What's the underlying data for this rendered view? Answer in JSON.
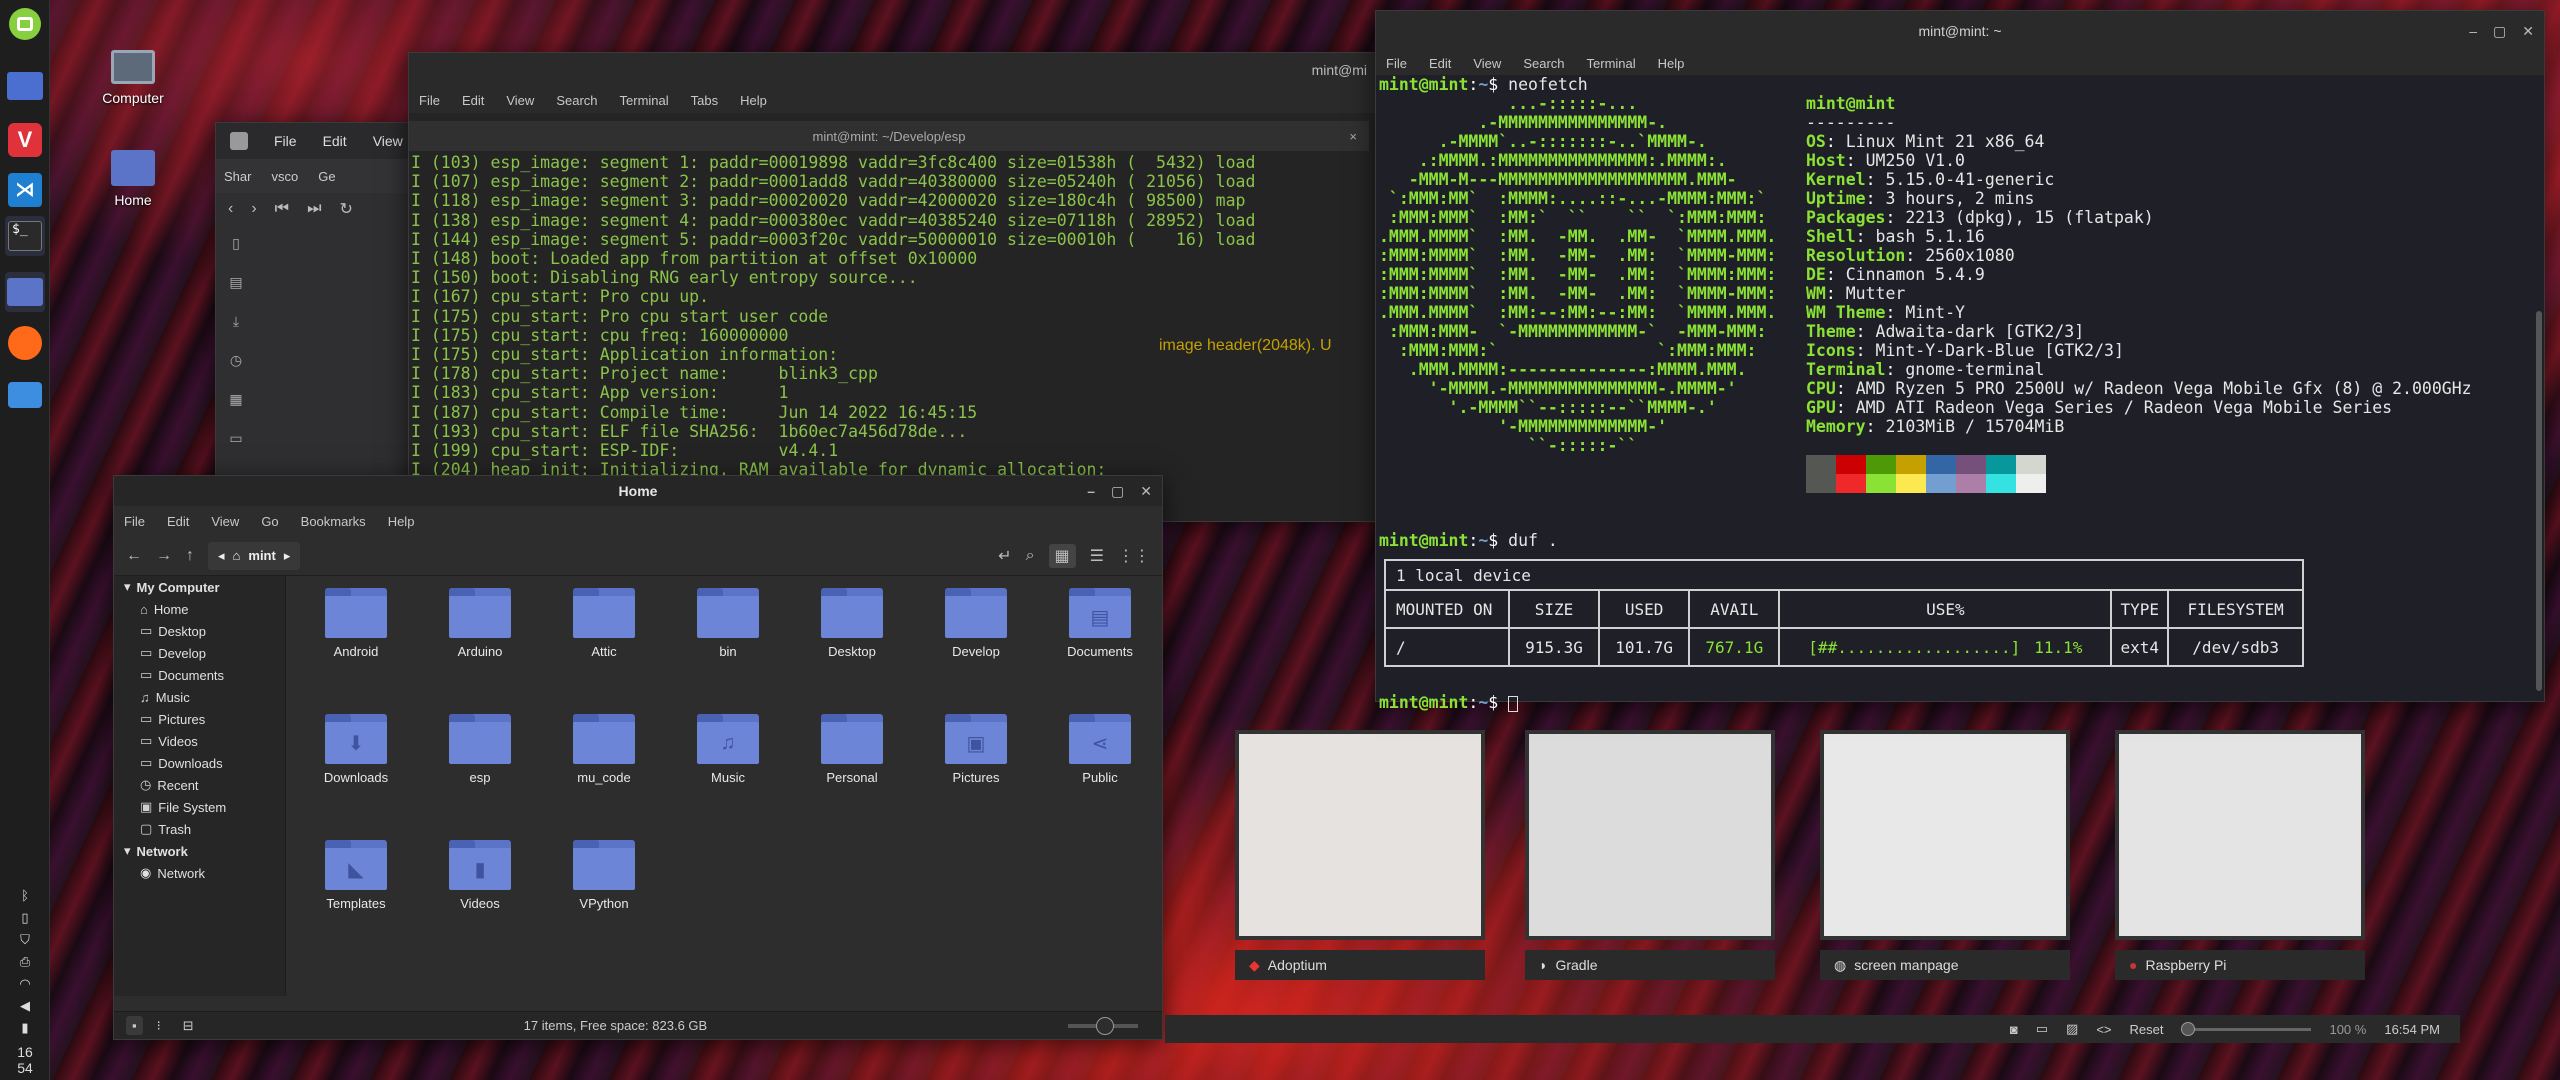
{
  "panel": {
    "clock_hour": "16",
    "clock_min": "54"
  },
  "desktop": {
    "computer_label": "Computer",
    "home_label": "Home"
  },
  "browser": {
    "menu": [
      "File",
      "Edit",
      "View"
    ],
    "tabs": [
      "Shar",
      "vsco",
      "Ge"
    ]
  },
  "term_back": {
    "title_short": "mint@mi",
    "tab_title": "mint@mint: ~/Develop/esp",
    "menu": [
      "File",
      "Edit",
      "View",
      "Search",
      "Terminal",
      "Tabs",
      "Help"
    ],
    "lines": [
      "I (103) esp_image: segment 1: paddr=00019898 vaddr=3fc8c400 size=01538h (  5432) load",
      "I (107) esp_image: segment 2: paddr=0001add8 vaddr=40380000 size=05240h ( 21056) load",
      "I (118) esp_image: segment 3: paddr=00020020 vaddr=42000020 size=180c4h ( 98500) map",
      "I (138) esp_image: segment 4: paddr=000380ec vaddr=40385240 size=07118h ( 28952) load",
      "I (144) esp_image: segment 5: paddr=0003f20c vaddr=50000010 size=00010h (    16) load",
      "I (148) boot: Loaded app from partition at offset 0x10000",
      "I (150) boot: Disabling RNG early entropy source...",
      "I (167) cpu_start: Pro cpu up.",
      "I (175) cpu_start: Pro cpu start user code",
      "I (175) cpu_start: cpu freq: 160000000",
      "I (175) cpu_start: Application information:",
      "I (178) cpu_start: Project name:     blink3_cpp",
      "I (183) cpu_start: App version:      1",
      "I (187) cpu_start: Compile time:     Jun 14 2022 16:45:15",
      "I (193) cpu_start: ELF file SHA256:  1b60ec7a456d78de...",
      "I (199) cpu_start: ESP-IDF:          v4.4.1",
      "I (204) heap_init: Initializing. RAM available for dynamic allocation:"
    ],
    "partial": "image header(2048k). U"
  },
  "files": {
    "title": "Home",
    "menu": [
      "File",
      "Edit",
      "View",
      "Go",
      "Bookmarks",
      "Help"
    ],
    "location": "mint",
    "sidebar": {
      "my_computer": "My Computer",
      "places": [
        "Home",
        "Desktop",
        "Develop",
        "Documents",
        "Music",
        "Pictures",
        "Videos",
        "Downloads",
        "Recent",
        "File System",
        "Trash"
      ],
      "network": "Network",
      "network_items": [
        "Network"
      ]
    },
    "folders": [
      {
        "name": "Android",
        "icon": ""
      },
      {
        "name": "Arduino",
        "icon": ""
      },
      {
        "name": "Attic",
        "icon": ""
      },
      {
        "name": "bin",
        "icon": ""
      },
      {
        "name": "Desktop",
        "icon": ""
      },
      {
        "name": "Develop",
        "icon": ""
      },
      {
        "name": "Documents",
        "icon": "▤"
      },
      {
        "name": "Downloads",
        "icon": "⬇"
      },
      {
        "name": "esp",
        "icon": ""
      },
      {
        "name": "mu_code",
        "icon": ""
      },
      {
        "name": "Music",
        "icon": "♫"
      },
      {
        "name": "Personal",
        "icon": ""
      },
      {
        "name": "Pictures",
        "icon": "▣"
      },
      {
        "name": "Public",
        "icon": "⋖"
      },
      {
        "name": "Templates",
        "icon": "◣"
      },
      {
        "name": "Videos",
        "icon": "▮"
      },
      {
        "name": "VPython",
        "icon": ""
      }
    ],
    "status": "17 items, Free space: 823.6 GB"
  },
  "term_front": {
    "title": "mint@mint: ~",
    "menu": [
      "File",
      "Edit",
      "View",
      "Search",
      "Terminal",
      "Help"
    ],
    "prompt": "mint@mint",
    "cmd1": "neofetch",
    "ascii": [
      "             ...-:::::-...",
      "          .-MMMMMMMMMMMMMMM-.",
      "      .-MMMM`..-:::::::-..`MMMM-.",
      "    .:MMMM.:MMMMMMMMMMMMMMM:.MMMM:.",
      "   -MMM-M---MMMMMMMMMMMMMMMMMMM.MMM-",
      " `:MMM:MM`  :MMMM:....::-...-MMMM:MMM:`",
      " :MMM:MMM`  :MM:`  ``    ``  `:MMM:MMM:",
      ".MMM.MMMM`  :MM.  -MM.  .MM-  `MMMM.MMM.",
      ":MMM:MMMM`  :MM.  -MM-  .MM:  `MMMM-MMM:",
      ":MMM:MMMM`  :MM.  -MM-  .MM:  `MMMM:MMM:",
      ":MMM:MMMM`  :MM.  -MM-  .MM:  `MMMM-MMM:",
      ".MMM.MMMM`  :MM:--:MM:--:MM:  `MMMM.MMM.",
      " :MMM:MMM-  `-MMMMMMMMMMMM-`  -MMM-MMM:",
      "  :MMM:MMM:`                `:MMM:MMM:",
      "   .MMM.MMMM:--------------:MMMM.MMM.",
      "     '-MMMM.-MMMMMMMMMMMMMMM-.MMMM-'",
      "       '.-MMMM``--:::::--``MMMM-.'",
      "            '-MMMMMMMMMMMMM-'",
      "               ``-:::::-``"
    ],
    "info_user": "mint@mint",
    "info_sep": "---------",
    "info": [
      {
        "k": "OS",
        "v": "Linux Mint 21 x86_64"
      },
      {
        "k": "Host",
        "v": "UM250 V1.0"
      },
      {
        "k": "Kernel",
        "v": "5.15.0-41-generic"
      },
      {
        "k": "Uptime",
        "v": "3 hours, 2 mins"
      },
      {
        "k": "Packages",
        "v": "2213 (dpkg), 15 (flatpak)"
      },
      {
        "k": "Shell",
        "v": "bash 5.1.16"
      },
      {
        "k": "Resolution",
        "v": "2560x1080"
      },
      {
        "k": "DE",
        "v": "Cinnamon 5.4.9"
      },
      {
        "k": "WM",
        "v": "Mutter"
      },
      {
        "k": "WM Theme",
        "v": "Mint-Y"
      },
      {
        "k": "Theme",
        "v": "Adwaita-dark [GTK2/3]"
      },
      {
        "k": "Icons",
        "v": "Mint-Y-Dark-Blue [GTK2/3]"
      },
      {
        "k": "Terminal",
        "v": "gnome-terminal"
      },
      {
        "k": "CPU",
        "v": "AMD Ryzen 5 PRO 2500U w/ Radeon Vega Mobile Gfx (8) @ 2.000GHz"
      },
      {
        "k": "GPU",
        "v": "AMD ATI Radeon Vega Series / Radeon Vega Mobile Series"
      },
      {
        "k": "Memory",
        "v": "2103MiB / 15704MiB"
      }
    ],
    "palette_top": [
      "#555753",
      "#cc0000",
      "#4e9a06",
      "#c4a000",
      "#3465a4",
      "#75507b",
      "#06989a",
      "#d3d7cf"
    ],
    "palette_bottom": [
      "#555753",
      "#ef2929",
      "#8ae234",
      "#fce94f",
      "#729fcf",
      "#ad7fa8",
      "#34e2e2",
      "#eeeeec"
    ],
    "cmd2": "duf .",
    "duf_title": "1 local device",
    "duf_headers": [
      "MOUNTED ON",
      "SIZE",
      "USED",
      "AVAIL",
      "USE%",
      "TYPE",
      "FILESYSTEM"
    ],
    "duf_row": [
      "/",
      "915.3G",
      "101.7G",
      "767.1G",
      "[##..................]",
      "11.1%",
      "ext4",
      "/dev/sdb3"
    ]
  },
  "overview": {
    "captions": [
      "Adoptium",
      "Gradle",
      "screen manpage",
      "Raspberry Pi"
    ],
    "reset": "Reset",
    "zoom": "100 %",
    "time": "16:54 PM"
  }
}
